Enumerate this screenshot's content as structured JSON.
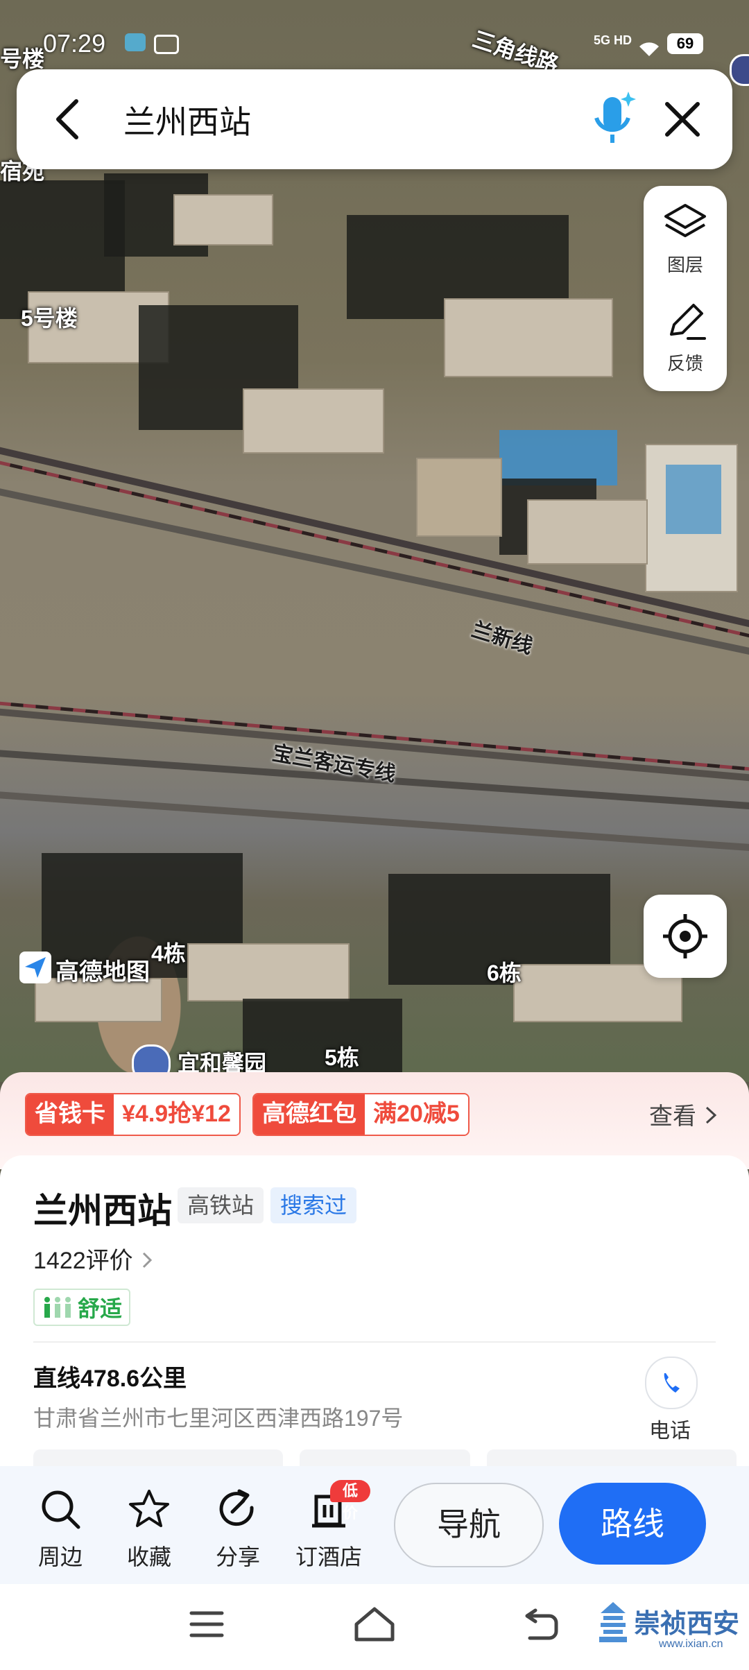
{
  "status_bar": {
    "time": "07:29",
    "network": "5G HD",
    "battery": "69"
  },
  "search": {
    "query": "兰州西站"
  },
  "map_controls": {
    "layers_label": "图层",
    "feedback_label": "反馈"
  },
  "map": {
    "labels": [
      "号楼",
      "三角线路",
      "宿苑",
      "5号楼",
      "兰新线",
      "宝兰客运专线",
      "4栋",
      "6栋",
      "5栋",
      "宜和馨园"
    ],
    "logo_text": "高德地图"
  },
  "promo": {
    "card": {
      "left": "省钱卡",
      "right": "¥4.9抢¥12"
    },
    "redpacket": {
      "left": "高德红包",
      "right": "满20减5"
    },
    "more": "查看"
  },
  "place": {
    "name": "兰州西站",
    "category": "高铁站",
    "searched_tag": "搜索过",
    "reviews": "1422评价",
    "comfort": "舒适",
    "distance": "直线478.6公里",
    "address": "甘肃省兰州市七里河区西津西路197号",
    "phone_label": "电话"
  },
  "actions": {
    "nearby": "周边",
    "favorite": "收藏",
    "share": "分享",
    "hotel": "订酒店",
    "hotel_badge": "低价",
    "navigate": "导航",
    "route": "路线"
  },
  "watermark": {
    "text": "崇祯西安",
    "url": "www.ixian.cn"
  }
}
